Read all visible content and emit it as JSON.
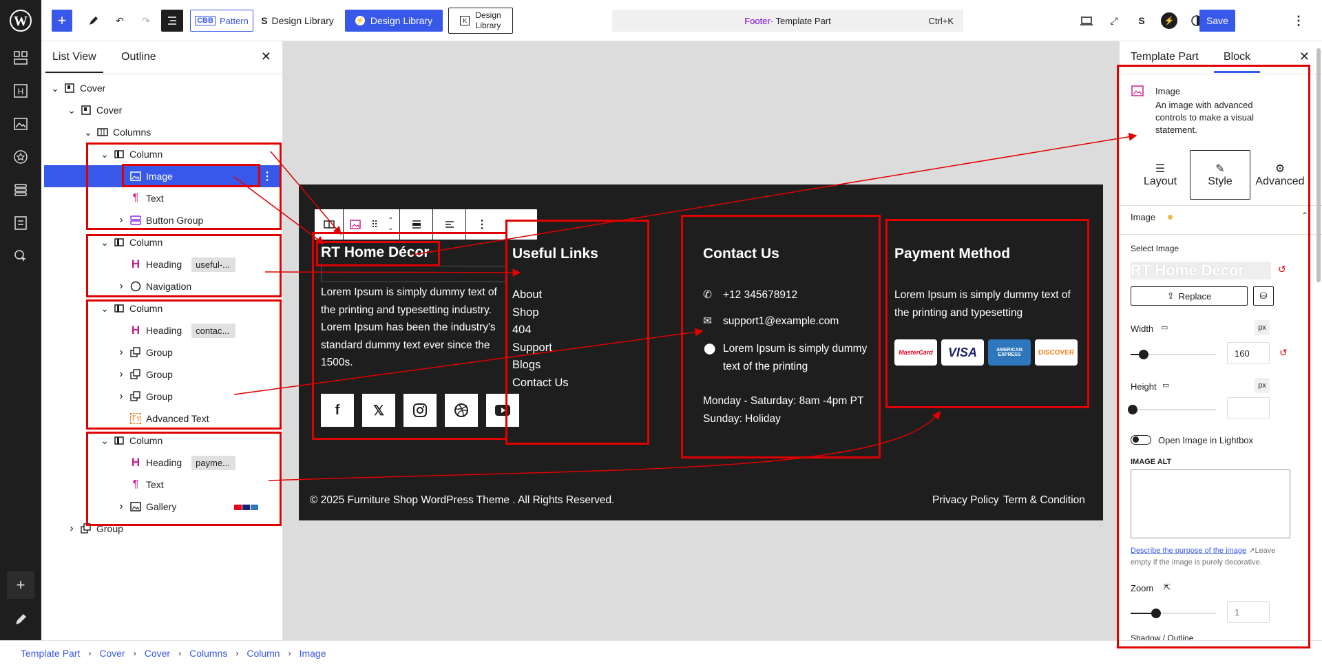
{
  "topbar": {
    "pattern_label": "Pattern",
    "cbb_badge": "CBB",
    "design_library_1": "Design Library",
    "design_library_2": "Design Library",
    "design_library_3_line1": "Design",
    "design_library_3_line2": "Library",
    "command": {
      "title": "Footer",
      "suffix": " · Template Part",
      "shortcut": "Ctrl+K"
    },
    "save_label": "Save"
  },
  "listview": {
    "tabs": [
      "List View",
      "Outline"
    ],
    "rows": [
      {
        "label": "Cover"
      },
      {
        "label": "Cover"
      },
      {
        "label": "Columns"
      },
      {
        "label": "Column"
      },
      {
        "label": "Image"
      },
      {
        "label": "Text"
      },
      {
        "label": "Button Group"
      },
      {
        "label": "Column"
      },
      {
        "label": "Heading",
        "pill": "useful-..."
      },
      {
        "label": "Navigation"
      },
      {
        "label": "Column"
      },
      {
        "label": "Heading",
        "pill": "contac..."
      },
      {
        "label": "Group"
      },
      {
        "label": "Group"
      },
      {
        "label": "Group"
      },
      {
        "label": "Advanced Text"
      },
      {
        "label": "Column"
      },
      {
        "label": "Heading",
        "pill": "payme..."
      },
      {
        "label": "Text"
      },
      {
        "label": "Gallery"
      },
      {
        "label": "Group"
      }
    ]
  },
  "footer": {
    "brand": "RT Home Décor",
    "about_text": "Lorem Ipsum is simply dummy text of the printing and typesetting industry. Lorem Ipsum has been the industry's standard dummy text ever since the 1500s.",
    "useful_links_title": "Useful Links",
    "links": [
      "About",
      "Shop",
      "404",
      "Support",
      "Blogs",
      "Contact Us"
    ],
    "contact_title": "Contact Us",
    "phone": "+12 345678912",
    "email": "support1@example.com",
    "address": "Lorem Ipsum is simply dummy text of the printing",
    "hours_1": "Monday - Saturday: 8am -4pm PT",
    "hours_2": "Sunday: Holiday",
    "payment_title": "Payment Method",
    "payment_text": "Lorem Ipsum is simply dummy text of the printing and typesetting",
    "cards": [
      "MasterCard",
      "VISA",
      "AMERICAN EXPRESS",
      "DISCOVER"
    ],
    "copyright": "© 2025 Furniture Shop WordPress Theme . All Rights Reserved.",
    "privacy": "Privacy Policy",
    "terms": "Term & Condition"
  },
  "settings": {
    "tabs": [
      "Template Part",
      "Block"
    ],
    "block_name": "Image",
    "block_desc": "An image with advanced controls to make a visual statement.",
    "subtabs": [
      "Layout",
      "Style",
      "Advanced"
    ],
    "section_title": "Image",
    "select_image_label": "Select Image",
    "preview_text": "RT Home Décor",
    "replace_label": "Replace",
    "width_label": "Width",
    "width_value": "160",
    "width_slider_fraction": 0.15,
    "height_label": "Height",
    "height_value": "",
    "unit": "px",
    "lightbox_label": "Open Image in Lightbox",
    "alt_label": "IMAGE ALT",
    "alt_help_link": "Describe the purpose of the image",
    "alt_help_text": "Leave empty if the image is purely decorative.",
    "zoom_label": "Zoom",
    "zoom_value": "1",
    "zoom_slider_fraction": 0.3,
    "cut_off_label": "Shadow / Outline"
  },
  "breadcrumb": [
    "Template Part",
    "Cover",
    "Cover",
    "Columns",
    "Column",
    "Image"
  ],
  "colors": {
    "accent": "#3858e9",
    "highlight": "#e00000",
    "footer_bg": "#1e1e1e",
    "heading_icon": "#cc1f8a"
  }
}
